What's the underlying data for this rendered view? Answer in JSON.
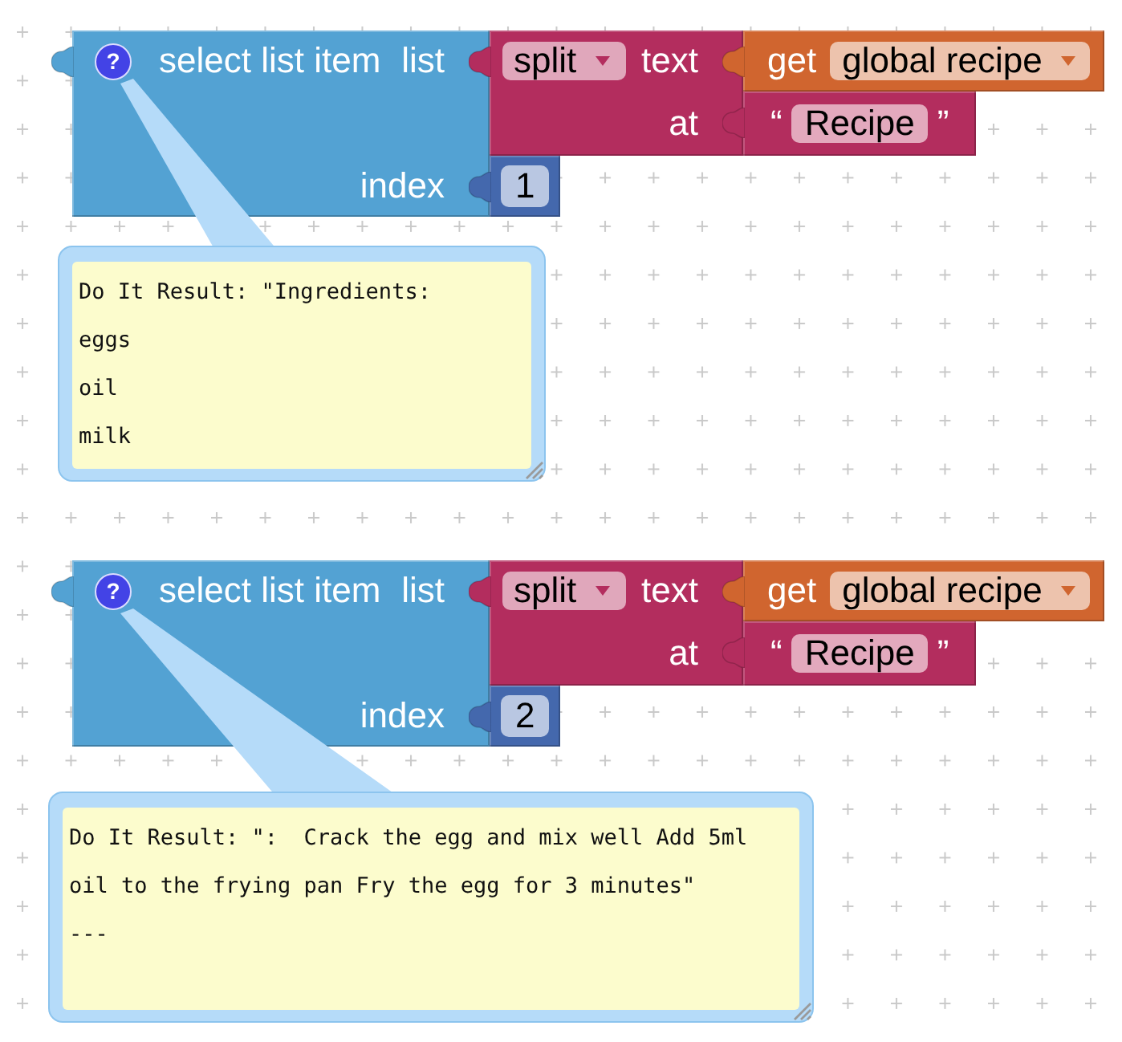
{
  "workspace": {
    "blocks": [
      {
        "kind": "select_list_item",
        "help": "?",
        "label": "select list item",
        "inputs": [
          {
            "label": "list",
            "value": {
              "kind": "split",
              "dropdown": "split",
              "inputs": [
                {
                  "label": "text",
                  "value": {
                    "kind": "get",
                    "label": "get",
                    "dropdown": "global recipe"
                  }
                },
                {
                  "label": "at",
                  "value": {
                    "kind": "text",
                    "open_quote": "“",
                    "text": "Recipe",
                    "close_quote": "”"
                  }
                }
              ]
            }
          },
          {
            "label": "index",
            "value": {
              "kind": "number",
              "value": "1"
            }
          }
        ],
        "result": {
          "lines": [
            "Do It Result: \"Ingredients:",
            "eggs",
            "oil",
            "milk"
          ]
        }
      },
      {
        "kind": "select_list_item",
        "help": "?",
        "label": "select list item",
        "inputs": [
          {
            "label": "list",
            "value": {
              "kind": "split",
              "dropdown": "split",
              "inputs": [
                {
                  "label": "text",
                  "value": {
                    "kind": "get",
                    "label": "get",
                    "dropdown": "global recipe"
                  }
                },
                {
                  "label": "at",
                  "value": {
                    "kind": "text",
                    "open_quote": "“",
                    "text": "Recipe",
                    "close_quote": "”"
                  }
                }
              ]
            }
          },
          {
            "label": "index",
            "value": {
              "kind": "number",
              "value": "2"
            }
          }
        ],
        "result": {
          "lines": [
            "Do It Result: \":  Crack the egg and mix well Add 5ml",
            "oil to the frying pan Fry the egg for 3 minutes\"",
            "---"
          ]
        }
      }
    ]
  }
}
